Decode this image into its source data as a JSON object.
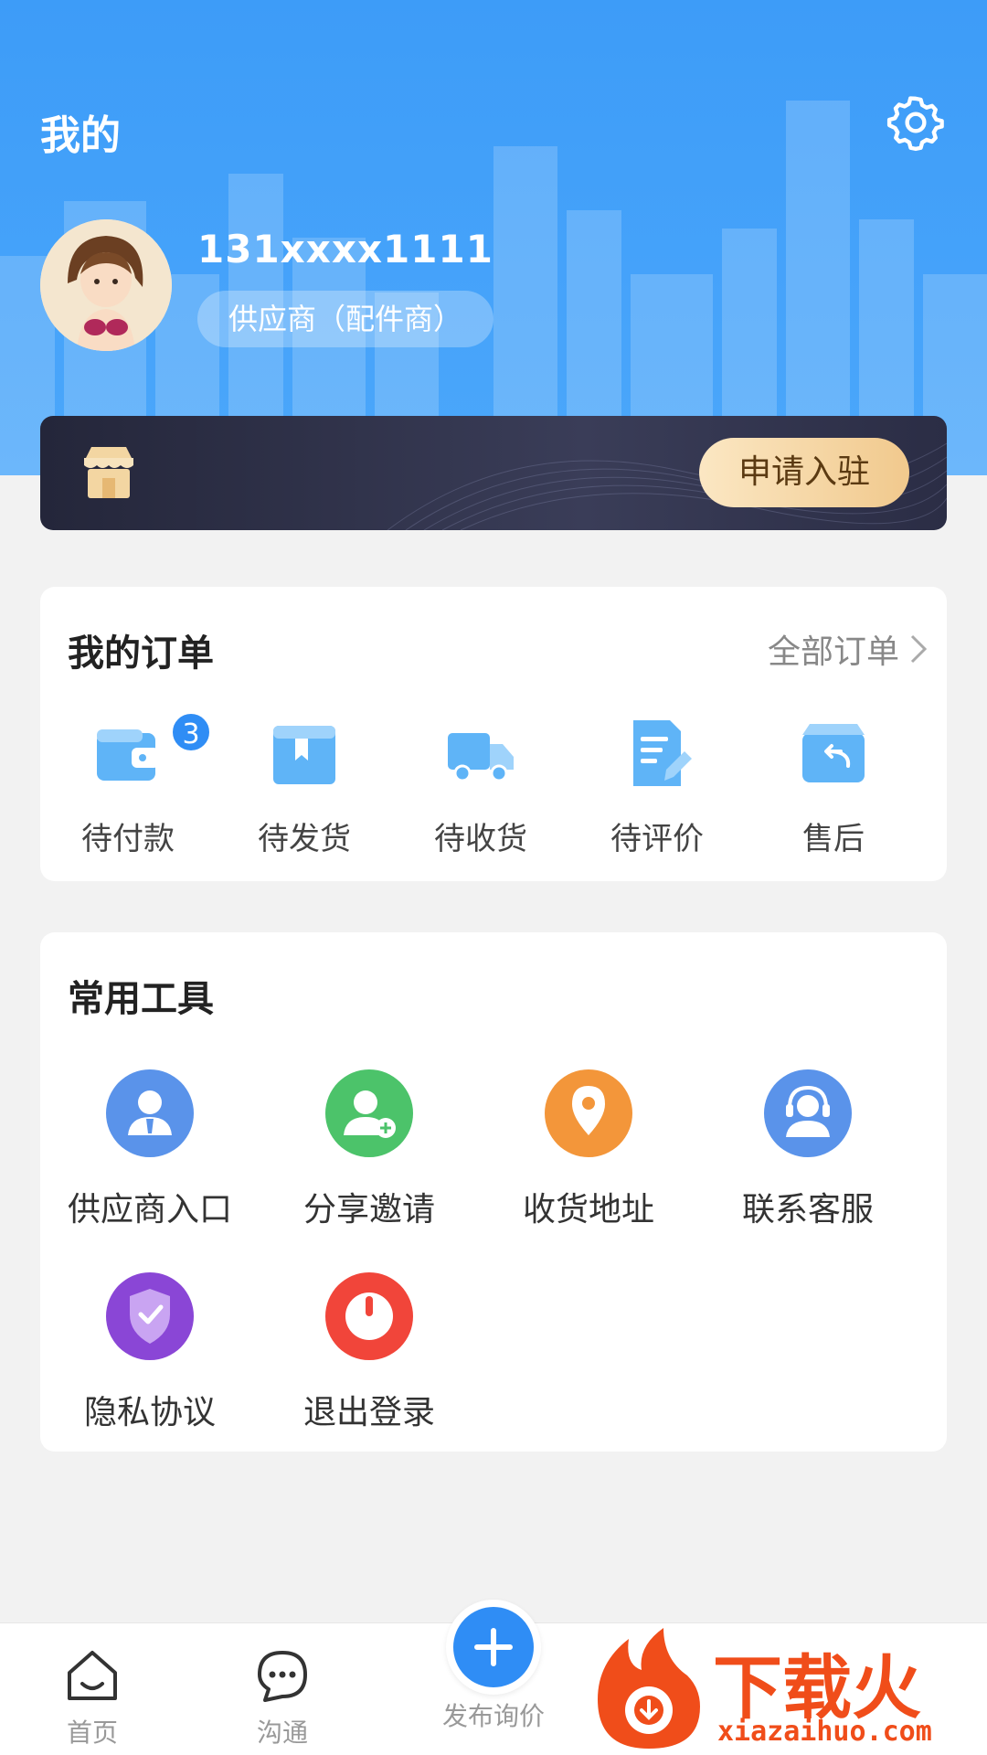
{
  "header": {
    "title": "我的",
    "settings_icon": "gear-icon",
    "user": {
      "phone": "131xxxx1111",
      "role": "供应商（配件商）"
    }
  },
  "banner": {
    "icon": "shop-icon",
    "apply_label": "申请入驻"
  },
  "orders": {
    "title": "我的订单",
    "all_label": "全部订单",
    "items": [
      {
        "label": "待付款",
        "icon": "wallet-icon",
        "badge": "3"
      },
      {
        "label": "待发货",
        "icon": "box-icon"
      },
      {
        "label": "待收货",
        "icon": "truck-icon"
      },
      {
        "label": "待评价",
        "icon": "edit-document-icon"
      },
      {
        "label": "售后",
        "icon": "return-box-icon"
      }
    ]
  },
  "tools": {
    "title": "常用工具",
    "items": [
      {
        "label": "供应商入口",
        "icon": "supplier-user-icon",
        "color": "#4f8ef0"
      },
      {
        "label": "分享邀请",
        "icon": "add-user-icon",
        "color": "#4cc36a"
      },
      {
        "label": "收货地址",
        "icon": "location-pin-icon",
        "color": "#f3963a"
      },
      {
        "label": "联系客服",
        "icon": "headset-icon",
        "color": "#4f8ef0"
      },
      {
        "label": "隐私协议",
        "icon": "shield-check-icon",
        "color": "#8a46d6"
      },
      {
        "label": "退出登录",
        "icon": "power-icon",
        "color": "#f1453a"
      }
    ]
  },
  "bottom_nav": {
    "items": [
      {
        "label": "首页",
        "icon": "home-icon"
      },
      {
        "label": "沟通",
        "icon": "chat-icon"
      }
    ],
    "publish_label": "发布询价",
    "publish_icon": "plus-icon"
  },
  "watermark": {
    "text": "下载火",
    "sub": "xiazaihuo.com"
  }
}
